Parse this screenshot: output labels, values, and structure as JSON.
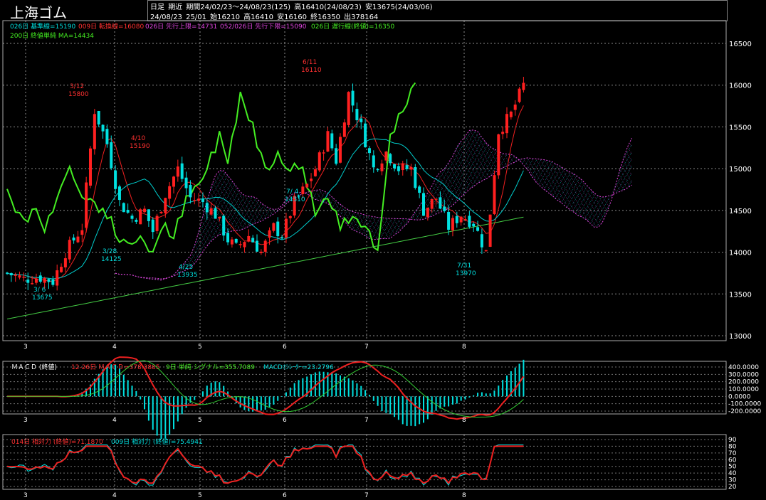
{
  "header": {
    "title": "上海ゴム",
    "line1": [
      "日足",
      "期近",
      "期間24/02/23〜24/08/23(125)",
      "高16410(24/08/23)",
      "安13675(24/03/06)"
    ],
    "line2": [
      "24/08/23",
      "25/01",
      "始16210",
      "高16410",
      "安16160",
      "終16350",
      "出378164"
    ]
  },
  "legend_main": {
    "kijun": "026日 基準線=15190",
    "tenkan": "009日 転換線=16080",
    "senkou_a": "026日 先行上限=14731",
    "senkou_b": "052/026日 先行下限=15090",
    "chikou": "026日 遅行線(終値)=16350",
    "ma200": "200日 終値単純 MA=14434"
  },
  "legend_macd": {
    "label": "ＭＡＣＤ (終値)",
    "macd": "12-26日 ＭＡＣＤ=378.3885",
    "signal": "9日 単純 シグナル=355.7089",
    "osc": "MACDｵｼﾚｰﾀｰ=23.2796"
  },
  "legend_rsi": {
    "rsi14": "014日 相対力 (終値)=71.1870",
    "rsi9": "009日 相対力 (終値)=75.4941"
  },
  "colors": {
    "up": "#ff2020",
    "down": "#00e0e0",
    "chikou": "#44ee22",
    "ma200": "#44cc44",
    "tenkan": "#ee2020",
    "kijun": "#00cccc",
    "cloud": "#dd44dd",
    "macd": "#ee2020",
    "signal": "#33cc33"
  },
  "chart_data": {
    "type": "candlestick",
    "y_axis_main": [
      "16500",
      "16000",
      "15500",
      "15000",
      "14500",
      "14000",
      "13500",
      "13000"
    ],
    "y_axis_macd": [
      "400.0000",
      "300.0000",
      "200.0000",
      "100.0000",
      "0.0000",
      "-100.0000",
      "-200.0000"
    ],
    "y_axis_rsi": [
      "90",
      "80",
      "70",
      "60",
      "50",
      "40",
      "30",
      "20"
    ],
    "x_labels": [
      "3",
      "4",
      "5",
      "6",
      "7",
      "8"
    ],
    "annotations": [
      {
        "date": "3/12",
        "price": "15800",
        "kind": "high"
      },
      {
        "date": "4/10",
        "price": "15190",
        "kind": "high"
      },
      {
        "date": "6/11",
        "price": "16110",
        "kind": "high"
      },
      {
        "date": "3/ 6",
        "price": "13675",
        "kind": "low"
      },
      {
        "date": "3/28",
        "price": "14125",
        "kind": "low"
      },
      {
        "date": "4/25",
        "price": "13935",
        "kind": "low"
      },
      {
        "date": "7/31",
        "price": "13970",
        "kind": "low"
      },
      {
        "date": "7/ 4",
        "price": "14310",
        "kind": "low"
      }
    ]
  }
}
